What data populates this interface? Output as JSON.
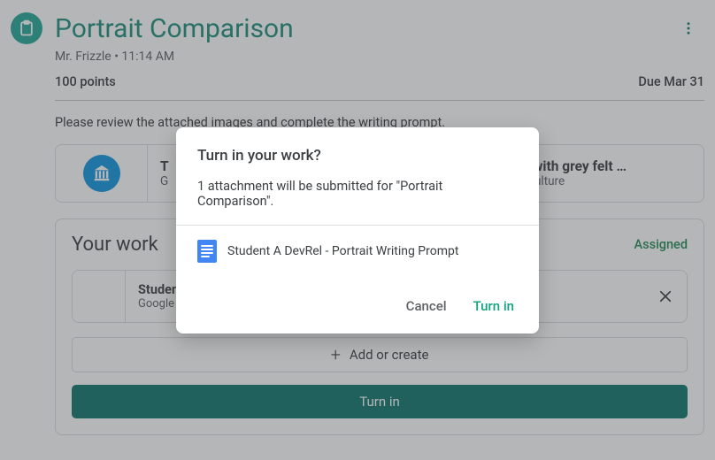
{
  "header": {
    "title": "Portrait Comparison",
    "teacher": "Mr. Frizzle",
    "time": "11:14 AM",
    "byline_separator": " • "
  },
  "meta": {
    "points": "100 points",
    "due": "Due Mar 31"
  },
  "prompt": "Please review the attached images and complete the writing prompt.",
  "attachments": [
    {
      "title": "T",
      "source": "G",
      "icon": "museum-icon"
    },
    {
      "title": "ortrait with grey felt …",
      "source": "Arts & Culture",
      "icon": "museum-icon"
    }
  ],
  "work": {
    "heading": "Your work",
    "status": "Assigned",
    "attachment": {
      "title": "Student",
      "source": "Google"
    },
    "add_label": "Add or create",
    "turnin_label": "Turn in"
  },
  "dialog": {
    "title": "Turn in your work?",
    "body": "1 attachment will be submitted for \"Portrait Comparison\".",
    "attachment_name": "Student A DevRel - Portrait Writing Prompt",
    "cancel": "Cancel",
    "submit": "Turn in"
  }
}
